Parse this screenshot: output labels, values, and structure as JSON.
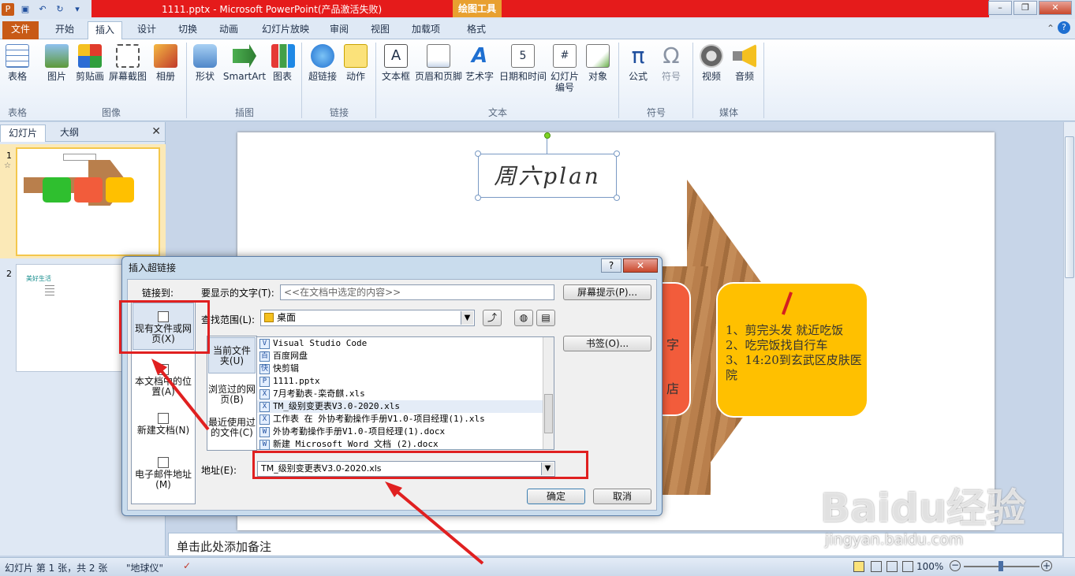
{
  "window": {
    "title": "1111.pptx - Microsoft PowerPoint(产品激活失败)",
    "context_tab": "绘图工具"
  },
  "tabs": [
    "文件",
    "开始",
    "插入",
    "设计",
    "切换",
    "动画",
    "幻灯片放映",
    "审阅",
    "视图",
    "加载项",
    "格式"
  ],
  "ribbon": {
    "buttons": [
      "表格",
      "图片",
      "剪贴画",
      "屏幕截图",
      "相册",
      "形状",
      "SmartArt",
      "图表",
      "超链接",
      "动作",
      "文本框",
      "页眉和页脚",
      "艺术字",
      "日期和时间",
      "幻灯片\n编号",
      "对象",
      "公式",
      "符号",
      "视频",
      "音频"
    ],
    "groups": [
      "表格",
      "图像",
      "插图",
      "链接",
      "文本",
      "符号",
      "媒体"
    ]
  },
  "panel": {
    "tabs": [
      "幻灯片",
      "大纲"
    ],
    "thumb2_title": "美好生活",
    "slide_numbers": [
      "1",
      "2"
    ]
  },
  "slide": {
    "title_text": "周六plan",
    "box_lines": [
      "1、剪完头发 就近吃饭",
      "2、吃完饭找自行车",
      "3、14:20到玄武区皮肤医",
      "院"
    ],
    "partial_texts": [
      "字",
      "店"
    ]
  },
  "notes": "单击此处添加备注",
  "status": {
    "slide_info": "幻灯片 第 1 张，共 2 张",
    "theme": "\"地球仪\"",
    "zoom": "100%"
  },
  "dialog": {
    "title": "插入超链接",
    "link_to_label": "链接到:",
    "display_text_label": "要显示的文字(T):",
    "display_text_value": "<<在文档中选定的内容>>",
    "screentip_button": "屏幕提示(P)...",
    "lookin_label": "查找范围(L):",
    "lookin_value": "桌面",
    "bookmark_button": "书签(O)...",
    "left_options": [
      "现有文件或网页(X)",
      "本文档中的位置(A)",
      "新建文档(N)",
      "电子邮件地址(M)"
    ],
    "mid_options": [
      "当前文件夹(U)",
      "浏览过的网页(B)",
      "最近使用过的文件(C)"
    ],
    "files": [
      {
        "icon": "V",
        "name": "Visual Studio Code"
      },
      {
        "icon": "百",
        "name": "百度网盘"
      },
      {
        "icon": "快",
        "name": "快剪辑"
      },
      {
        "icon": "P",
        "name": "1111.pptx"
      },
      {
        "icon": "X",
        "name": "7月考勤表-栾奇麒.xls"
      },
      {
        "icon": "X",
        "name": "TM_级别变更表V3.0-2020.xls"
      },
      {
        "icon": "X",
        "name": "工作表 在 外协考勤操作手册V1.0-项目经理(1).xls"
      },
      {
        "icon": "W",
        "name": "外协考勤操作手册V1.0-项目经理(1).docx"
      },
      {
        "icon": "W",
        "name": "新建 Microsoft Word 文档 (2).docx"
      }
    ],
    "address_label": "地址(E):",
    "address_value": "TM_级别变更表V3.0-2020.xls",
    "ok": "确定",
    "cancel": "取消"
  },
  "watermark": {
    "brand": "Baidu经验",
    "url": "jingyan.baidu.com"
  },
  "colors": {
    "file_tab": "#c85a16",
    "title_red": "#e51b1b",
    "annotation": "#e02020",
    "yellow_box": "#ffc000",
    "red_box": "#f25c3b"
  }
}
